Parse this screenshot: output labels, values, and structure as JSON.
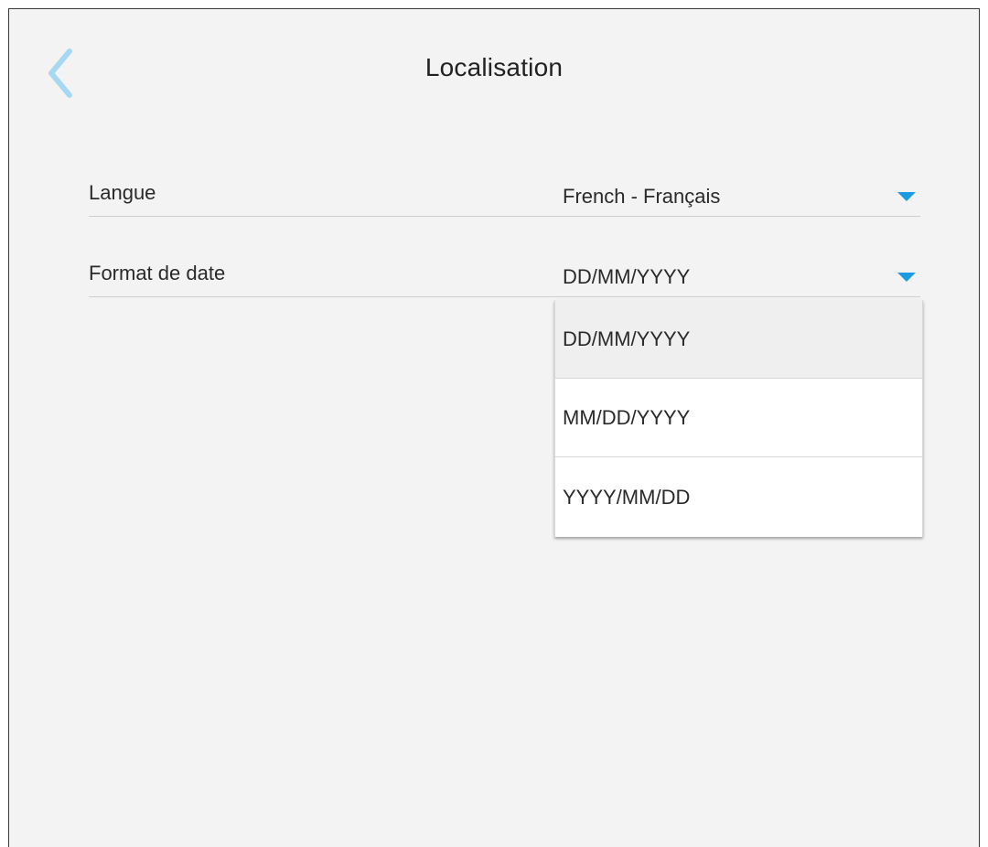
{
  "header": {
    "title": "Localisation",
    "back_icon": "chevron-left-icon"
  },
  "settings": {
    "language": {
      "label": "Langue",
      "value": "French - Français"
    },
    "date_format": {
      "label": "Format de date",
      "value": "DD/MM/YYYY",
      "options": [
        "DD/MM/YYYY",
        "MM/DD/YYYY",
        "YYYY/MM/DD"
      ]
    }
  },
  "colors": {
    "accent": "#1e9be0",
    "back_icon": "#a7d8f2",
    "background": "#f3f3f3"
  }
}
